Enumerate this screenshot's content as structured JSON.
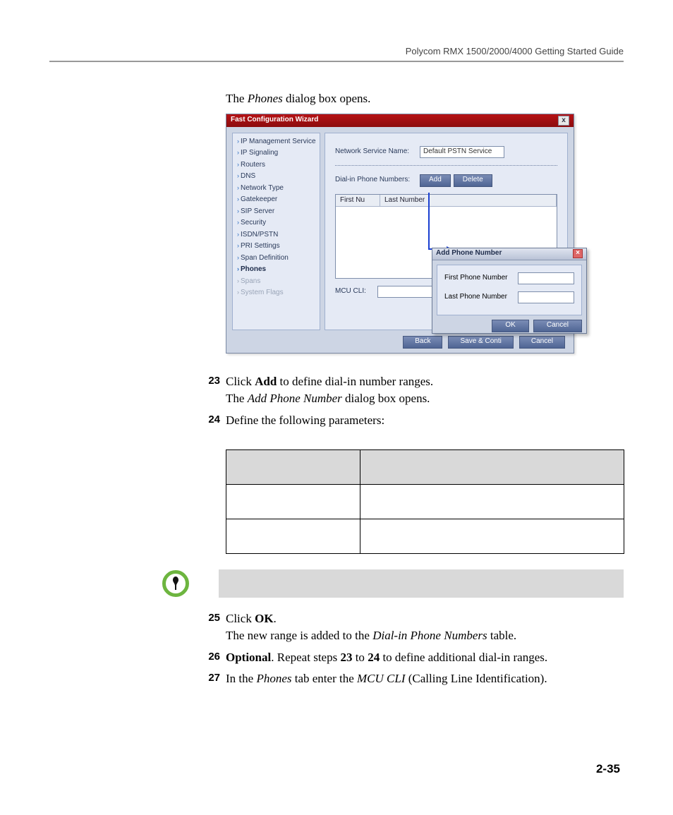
{
  "header": {
    "guide_title": "Polycom RMX 1500/2000/4000 Getting Started Guide"
  },
  "intro": {
    "pre": "The ",
    "dialog_name": "Phones",
    "post": " dialog box opens."
  },
  "wizard": {
    "title": "Fast Configuration Wizard",
    "close": "x",
    "side_items": [
      {
        "label": "IP Management Service",
        "dim": false
      },
      {
        "label": "IP Signaling",
        "dim": false
      },
      {
        "label": "Routers",
        "dim": false
      },
      {
        "label": "DNS",
        "dim": false
      },
      {
        "label": "Network Type",
        "dim": false
      },
      {
        "label": "Gatekeeper",
        "dim": false
      },
      {
        "label": "SIP Server",
        "dim": false
      },
      {
        "label": "Security",
        "dim": false
      },
      {
        "label": "ISDN/PSTN",
        "dim": false
      },
      {
        "label": "PRI Settings",
        "dim": false
      },
      {
        "label": "Span Definition",
        "dim": false
      },
      {
        "label": "Phones",
        "dim": false,
        "bold": true
      },
      {
        "label": "Spans",
        "dim": true
      },
      {
        "label": "System Flags",
        "dim": true
      }
    ],
    "svc_label": "Network Service Name:",
    "svc_value": "Default PSTN Service",
    "dial_label": "Dial-in Phone Numbers:",
    "btn_add": "Add",
    "btn_delete": "Delete",
    "col_first": "First Nu",
    "col_last": "Last Number",
    "mcu_label": "MCU CLI:",
    "mcu_value": "",
    "btn_back": "Back",
    "btn_save": "Save & Conti",
    "btn_cancel": "Cancel"
  },
  "subdlg": {
    "title": "Add Phone Number",
    "first_label": "First Phone Number",
    "last_label": "Last Phone Number",
    "ok": "OK",
    "cancel": "Cancel"
  },
  "step23": {
    "num": "23",
    "pre": "Click ",
    "action": "Add",
    "post": " to define dial-in number ranges.",
    "line2_pre": "The ",
    "line2_name": "Add Phone Number",
    "line2_post": " dialog box opens."
  },
  "step24": {
    "num": "24",
    "text": "Define the following parameters:"
  },
  "table": {
    "h1": "",
    "h2": "",
    "r1c1": "",
    "r1c2": "",
    "r2c1": "",
    "r2c2": ""
  },
  "note": {
    "text": ""
  },
  "step25": {
    "num": "25",
    "pre": "Click ",
    "action": "OK",
    "post": ".",
    "line2_pre": "The new range is added to the ",
    "line2_name": "Dial-in Phone Numbers",
    "line2_post": " table."
  },
  "step26": {
    "num": "26",
    "opt": "Optional",
    "mid1": ". Repeat steps ",
    "s1": "23",
    "mid2": " to ",
    "s2": "24",
    "post": " to define additional dial-in ranges."
  },
  "step27": {
    "num": "27",
    "pre": "In the ",
    "tab": "Phones",
    "mid": " tab enter the ",
    "field": "MCU CLI",
    "post": " (Calling Line Identification)."
  },
  "page_number": "2-35"
}
